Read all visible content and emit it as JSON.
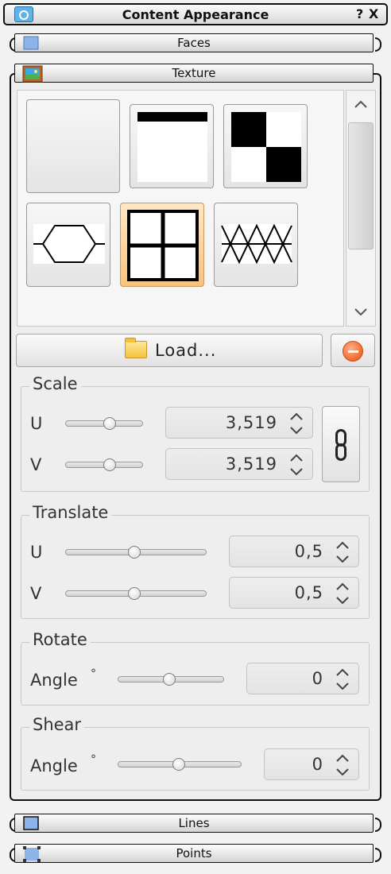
{
  "window": {
    "title": "Content Appearance",
    "help_label": "?",
    "close_label": "X",
    "icon": "content-appearance-icon"
  },
  "sections": {
    "faces": {
      "label": "Faces",
      "icon": "faces-icon"
    },
    "texture": {
      "label": "Texture",
      "icon": "texture-image-icon"
    },
    "lines": {
      "label": "Lines",
      "icon": "lines-icon"
    },
    "points": {
      "label": "Points",
      "icon": "points-icon"
    }
  },
  "texture_thumbnails": [
    {
      "name": "blank-texture",
      "selected": false
    },
    {
      "name": "stripe-texture",
      "selected": false
    },
    {
      "name": "checker-texture",
      "selected": false
    },
    {
      "name": "hexagon-texture",
      "selected": false
    },
    {
      "name": "grid-texture",
      "selected": true
    },
    {
      "name": "triangle-texture",
      "selected": false
    }
  ],
  "load": {
    "label": "Load...",
    "icon": "folder-icon"
  },
  "remove": {
    "icon": "remove-icon"
  },
  "scale": {
    "title": "Scale",
    "u_label": "U",
    "v_label": "V",
    "u_value": "3,519",
    "v_value": "3,519",
    "link_icon": "chain-link-icon"
  },
  "translate": {
    "title": "Translate",
    "u_label": "U",
    "v_label": "V",
    "u_value": "0,5",
    "v_value": "0,5"
  },
  "rotate": {
    "title": "Rotate",
    "angle_label": "Angle",
    "degree_symbol": "°",
    "value": "0"
  },
  "shear": {
    "title": "Shear",
    "angle_label": "Angle",
    "degree_symbol": "°",
    "value": "0"
  },
  "colors": {
    "accent_selected": "#f9c27e",
    "remove_button": "#f06a2a",
    "folder": "#f3c33d"
  }
}
